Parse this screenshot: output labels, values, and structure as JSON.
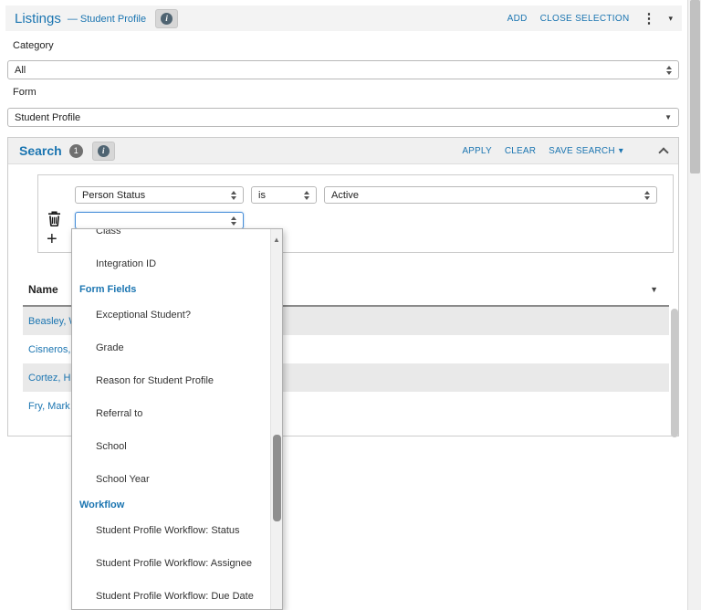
{
  "colors": {
    "accent_blue": "#1b75b1",
    "row_stripe": "#e9e9e9",
    "focus_border": "#4a90d9",
    "header_bar": "#f3f3f3"
  },
  "icons": {
    "info": "i",
    "kebab": "⋮",
    "caret_down": "▾",
    "column_caret": "▼",
    "scroll_up": "▲"
  },
  "header": {
    "title": "Listings",
    "subtitle": "— Student Profile",
    "actions": {
      "add": "ADD",
      "close_selection": "CLOSE SELECTION"
    }
  },
  "filters": {
    "category_label": "Category",
    "category_value": "All",
    "form_label": "Form",
    "form_value": "Student Profile"
  },
  "search": {
    "title": "Search",
    "badge": "1",
    "apply": "APPLY",
    "clear": "CLEAR",
    "save_search": "SAVE SEARCH",
    "condition": {
      "field": "Person Status",
      "operator": "is",
      "value": "Active"
    },
    "new_condition_value": "",
    "add_button": "+"
  },
  "field_dropdown": {
    "items": [
      {
        "label": "Class",
        "type": "option"
      },
      {
        "label": "Integration ID",
        "type": "option"
      },
      {
        "label": "Form Fields",
        "type": "group"
      },
      {
        "label": "Exceptional Student?",
        "type": "option"
      },
      {
        "label": "Grade",
        "type": "option"
      },
      {
        "label": "Reason for Student Profile",
        "type": "option"
      },
      {
        "label": "Referral to",
        "type": "option"
      },
      {
        "label": "School",
        "type": "option"
      },
      {
        "label": "School Year",
        "type": "option"
      },
      {
        "label": "Workflow",
        "type": "group"
      },
      {
        "label": "Student Profile Workflow: Status",
        "type": "option"
      },
      {
        "label": "Student Profile Workflow: Assignee",
        "type": "option"
      },
      {
        "label": "Student Profile Workflow: Due Date",
        "type": "option"
      }
    ]
  },
  "table": {
    "name_header": "Name",
    "rows": [
      {
        "name": "Beasley, W"
      },
      {
        "name": "Cisneros, J"
      },
      {
        "name": "Cortez, Ha"
      },
      {
        "name": "Fry, Mark"
      }
    ]
  }
}
